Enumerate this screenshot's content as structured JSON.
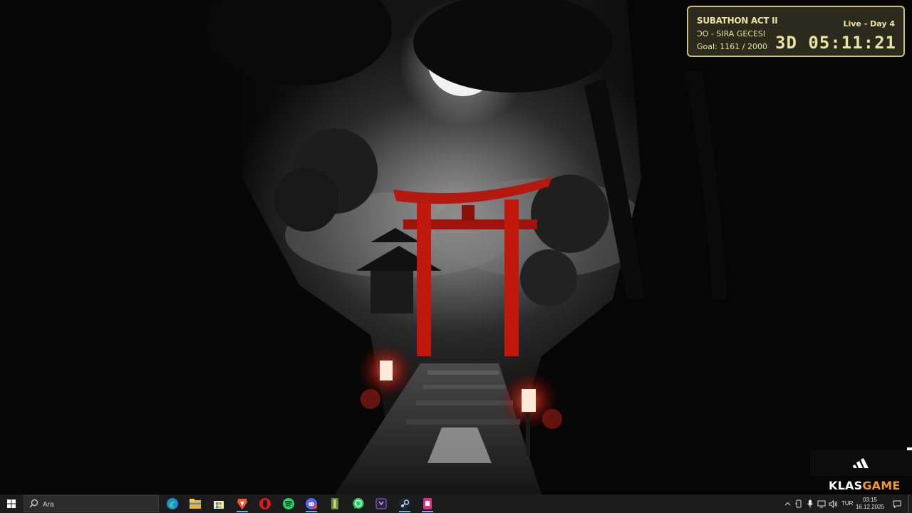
{
  "subathon": {
    "title": "SUBATHON ACT II",
    "status": "Live - Day 4",
    "marquee": "ƆO - SIRA GECESI",
    "goal": "Goal: 1161 / 2000",
    "timer": "3D  05:11:21"
  },
  "sponsor": {
    "logo_icon": "adidas-logo",
    "brand_part1": "KLAS",
    "brand_part2": "GAME",
    "brand_color": "#f39a1e"
  },
  "taskbar": {
    "search_placeholder": "Ara",
    "apps": [
      {
        "name": "edge-icon"
      },
      {
        "name": "file-explorer-icon"
      },
      {
        "name": "microsoft-store-icon"
      },
      {
        "name": "brave-icon"
      },
      {
        "name": "opera-icon"
      },
      {
        "name": "spotify-icon"
      },
      {
        "name": "discord-icon"
      },
      {
        "name": "minecraft-launcher-icon"
      },
      {
        "name": "whatsapp-icon"
      },
      {
        "name": "media-app-icon"
      },
      {
        "name": "steam-icon"
      },
      {
        "name": "notes-app-icon"
      }
    ],
    "language": "TUR",
    "time": "03:15",
    "date": "16.12.2025"
  }
}
